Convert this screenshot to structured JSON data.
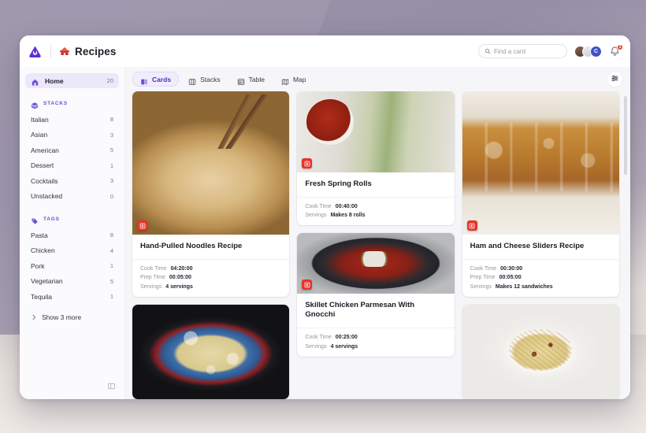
{
  "header": {
    "logo_icon": "craft-logo-icon",
    "board_icon": "recipe-emoji-icon",
    "board_title": "Recipes",
    "search": {
      "icon": "search-icon",
      "placeholder": "Find a card",
      "value": ""
    },
    "avatars": [
      {
        "name": "avatar-user-1",
        "initial": "",
        "color": "#5c4a3a"
      },
      {
        "name": "avatar-user-2",
        "initial": "",
        "color": "#d8dce6"
      },
      {
        "name": "avatar-user-3",
        "initial": "C",
        "color": "#4052c4"
      }
    ],
    "notifications": {
      "icon": "bell-icon",
      "badge": "1"
    }
  },
  "sidebar": {
    "home": {
      "icon": "home-icon",
      "label": "Home",
      "count": "20"
    },
    "stacks_section": {
      "icon": "stacks-icon",
      "label": "STACKS"
    },
    "stacks": [
      {
        "label": "Italian",
        "count": "8"
      },
      {
        "label": "Asian",
        "count": "3"
      },
      {
        "label": "American",
        "count": "5"
      },
      {
        "label": "Dessert",
        "count": "1"
      },
      {
        "label": "Cocktails",
        "count": "3"
      },
      {
        "label": "Unstacked",
        "count": "0"
      }
    ],
    "tags_section": {
      "icon": "tag-icon",
      "label": "TAGS"
    },
    "tags": [
      {
        "label": "Pasta",
        "count": "8"
      },
      {
        "label": "Chicken",
        "count": "4"
      },
      {
        "label": "Pork",
        "count": "1"
      },
      {
        "label": "Vegetarian",
        "count": "5"
      },
      {
        "label": "Tequila",
        "count": "1"
      }
    ],
    "show_more": {
      "icon": "chevron-right-icon",
      "label": "Show 3 more"
    },
    "collapse": {
      "icon": "collapse-sidebar-icon"
    }
  },
  "viewbar": {
    "tabs": [
      {
        "label": "Cards",
        "icon": "cards-icon",
        "active": true
      },
      {
        "label": "Stacks",
        "icon": "stacks-view-icon",
        "active": false
      },
      {
        "label": "Table",
        "icon": "table-icon",
        "active": false
      },
      {
        "label": "Map",
        "icon": "map-icon",
        "active": false
      }
    ],
    "settings": {
      "icon": "sliders-icon"
    }
  },
  "cards": {
    "meta_keys": {
      "cook": "Cook Time",
      "prep": "Prep Time",
      "servings": "Servings"
    },
    "items": [
      {
        "title": "Hand-Pulled Noodles Recipe",
        "badge_icon": "source-badge-icon",
        "cook_time": "04:20:00",
        "prep_time": "00:05:00",
        "servings": "4 servings"
      },
      {
        "title": "Fresh Spring Rolls",
        "badge_icon": "source-badge-icon",
        "cook_time": "00:40:00",
        "servings": "Makes 8 rolls"
      },
      {
        "title": "Ham and Cheese Sliders Recipe",
        "badge_icon": "source-badge-icon",
        "cook_time": "00:30:00",
        "prep_time": "00:05:00",
        "servings": "Makes 12 sandwiches"
      },
      {
        "title": "Skillet Chicken Parmesan With Gnocchi",
        "badge_icon": "source-badge-icon",
        "cook_time": "00:25:00",
        "servings": "4 servings"
      }
    ]
  },
  "colors": {
    "accent": "#6c4fd6",
    "accent_soft": "#ece7fb",
    "badge_red": "#e63329",
    "notification_red": "#e8432f",
    "content_bg": "#f6f5f8",
    "sidebar_bg": "#fbfafc"
  }
}
